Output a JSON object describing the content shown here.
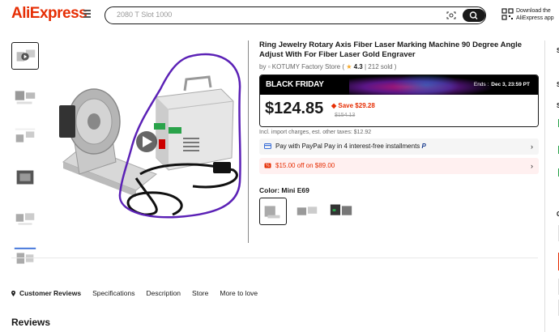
{
  "header": {
    "logo": "AliExpress",
    "search_placeholder": "2080 T Slot 1000",
    "download_line1": "Download the",
    "download_line2": "AliExpress app"
  },
  "product": {
    "title": "Ring Jewelry Rotary Axis Fiber Laser Marking Machine 90 Degree Angle Adjust With For Fiber Laser Gold Engraver",
    "by_prefix": "by",
    "store": "KOTUMY Factory Store",
    "rating": "4.3",
    "sold": "212 sold",
    "promo_label": "BLACK FRIDAY",
    "ends_label": "Ends :",
    "ends_value": "Dec 3, 23:59 PT",
    "price": "$124.85",
    "save": "Save $29.28",
    "original_price": "$154.13",
    "tax_note": "Incl. import charges, est. other taxes: $12.92",
    "paypal_text": "Pay with PayPal Pay in 4 interest-free installments",
    "coupon_text": "$15.00 off on $89.00",
    "color_label": "Color:",
    "color_value": "Mini E69"
  },
  "tabs": [
    {
      "label": "Customer Reviews"
    },
    {
      "label": "Specifications"
    },
    {
      "label": "Description"
    },
    {
      "label": "Store"
    },
    {
      "label": "More to love"
    }
  ],
  "reviews_heading": "Reviews",
  "colors": {
    "accent": "#e62e04",
    "annotation": "#5b21b6"
  }
}
